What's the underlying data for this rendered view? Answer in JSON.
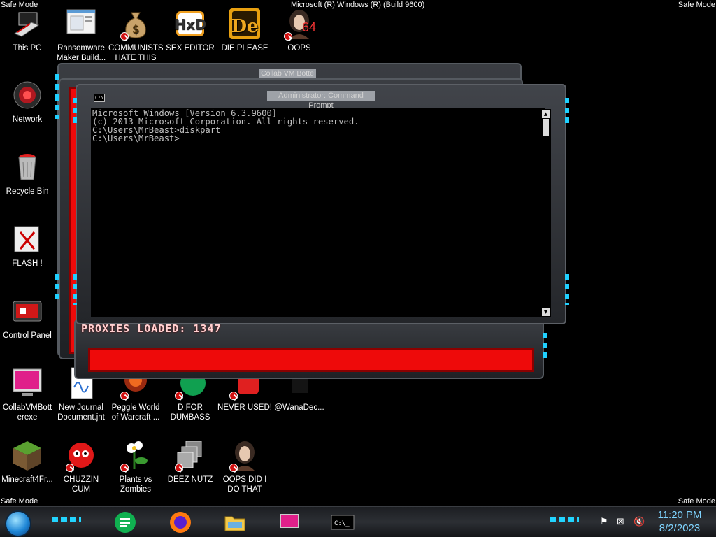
{
  "safe_mode": "Safe Mode",
  "build_text": "Microsoft (R) Windows (R) (Build 9600)",
  "desktop_icons": {
    "this_pc": "This PC",
    "ransomware": "Ransomware Maker Build...",
    "communists": "COMMUNISTS HATE THIS G...",
    "sex_editor": "SEX EDITOR",
    "die_please": "DIE PLEASE",
    "oops": "OOPS",
    "network": "Network",
    "recycle_bin": "Recycle Bin",
    "flash": "FLASH !",
    "control_panel": "Control Panel",
    "collabvm": "CollabVMBott erexe",
    "new_journal": "New Journal Document.jnt",
    "peggle": "Peggle World of Warcraft ...",
    "d_for": "D FOR DUMBASS",
    "never_used": "NEVER USED!",
    "wanadec": "@WanaDec...",
    "minecraft": "Minecraft4Fr...",
    "chuzzin": "CHUZZIN CUM",
    "plants": "Plants vs Zombies",
    "deez": "DEEZ NUTZ",
    "oops_did": "OOPS DID I DO THAT"
  },
  "back_window": {
    "title": "Collab VM Botte"
  },
  "cmd_window": {
    "title": "Administrator: Command Prompt",
    "icon_text": "C:\\",
    "lines": [
      "Microsoft Windows [Version 6.3.9600]",
      "(c) 2013 Microsoft Corporation. All rights reserved.",
      "",
      "C:\\Users\\MrBeast>diskpart",
      "",
      "C:\\Users\\MrBeast>"
    ]
  },
  "proxies_text": "PROXIES LOADED: 1347",
  "oops_badge": "64",
  "taskbar": {
    "time": "11:20 PM",
    "date": "8/2/2023",
    "cmd_icon_text": "C:\\_"
  },
  "colors": {
    "accent_cyan": "#22d4ff",
    "red_panel": "#ee0a0a",
    "clock_blue": "#7fd4ff"
  }
}
